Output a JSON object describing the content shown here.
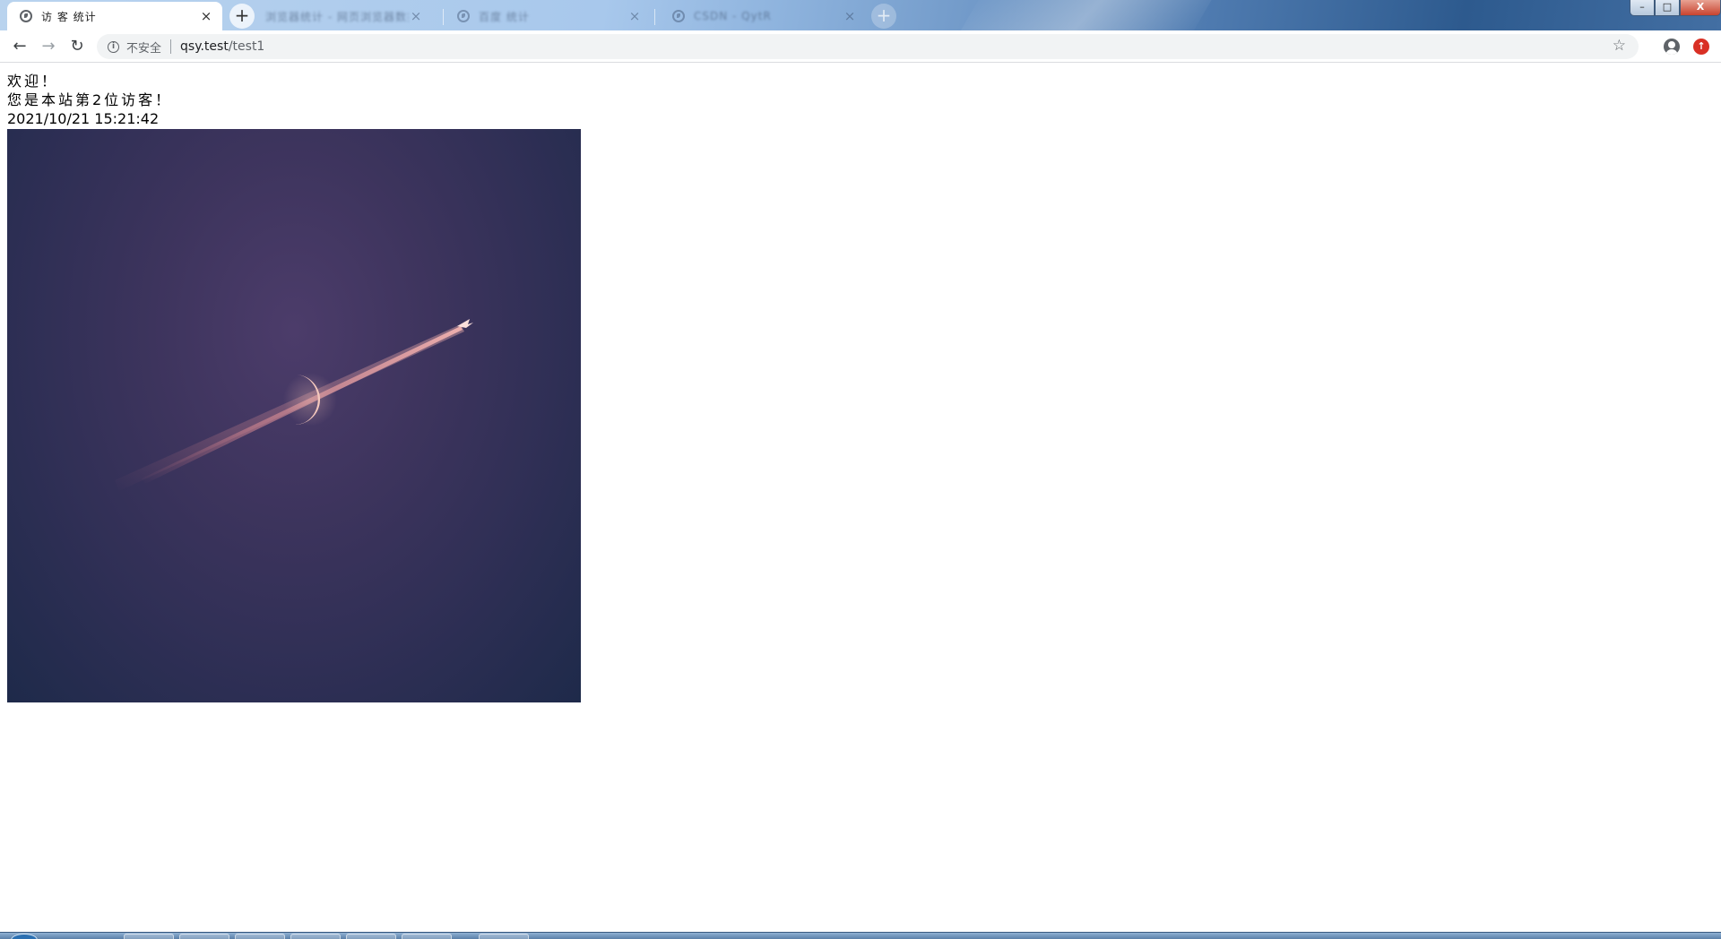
{
  "window": {
    "controls": {
      "minimize": "–",
      "maximize": "□",
      "close": "X"
    }
  },
  "tabs": [
    {
      "title": "访 客 统计",
      "active": true,
      "icon": "globe-icon"
    },
    {
      "title": "浏览器统计 - 网页浏览器数据 - 标签页",
      "active": false,
      "icon": "page-icon"
    },
    {
      "title": "百度 统计",
      "active": false,
      "icon": "globe-icon"
    },
    {
      "title": "CSDN - QytR",
      "active": false,
      "icon": "globe-icon"
    }
  ],
  "tab_close_glyph": "×",
  "new_tab_glyph": "+",
  "toolbar": {
    "back_glyph": "←",
    "forward_glyph": "→",
    "reload_glyph": "↻",
    "info_glyph": "i",
    "security_label": "不安全",
    "url_host": "qsy.test",
    "url_path": "/test1",
    "star_glyph": "☆",
    "update_glyph": "↑"
  },
  "page": {
    "welcome": "欢迎！",
    "visitor_message": "您是本站第2位访客！",
    "timestamp": "2021/10/21 15:21:42",
    "image_subject": "crescent moon crossed by an airplane contrail against a dusk sky"
  },
  "colors": {
    "omnibox_bg": "#f1f3f4",
    "sky_top": "#4c3c6a",
    "sky_bottom": "#1e2a4a",
    "contrail": "#e8a0a0",
    "update_badge": "#d93025"
  }
}
